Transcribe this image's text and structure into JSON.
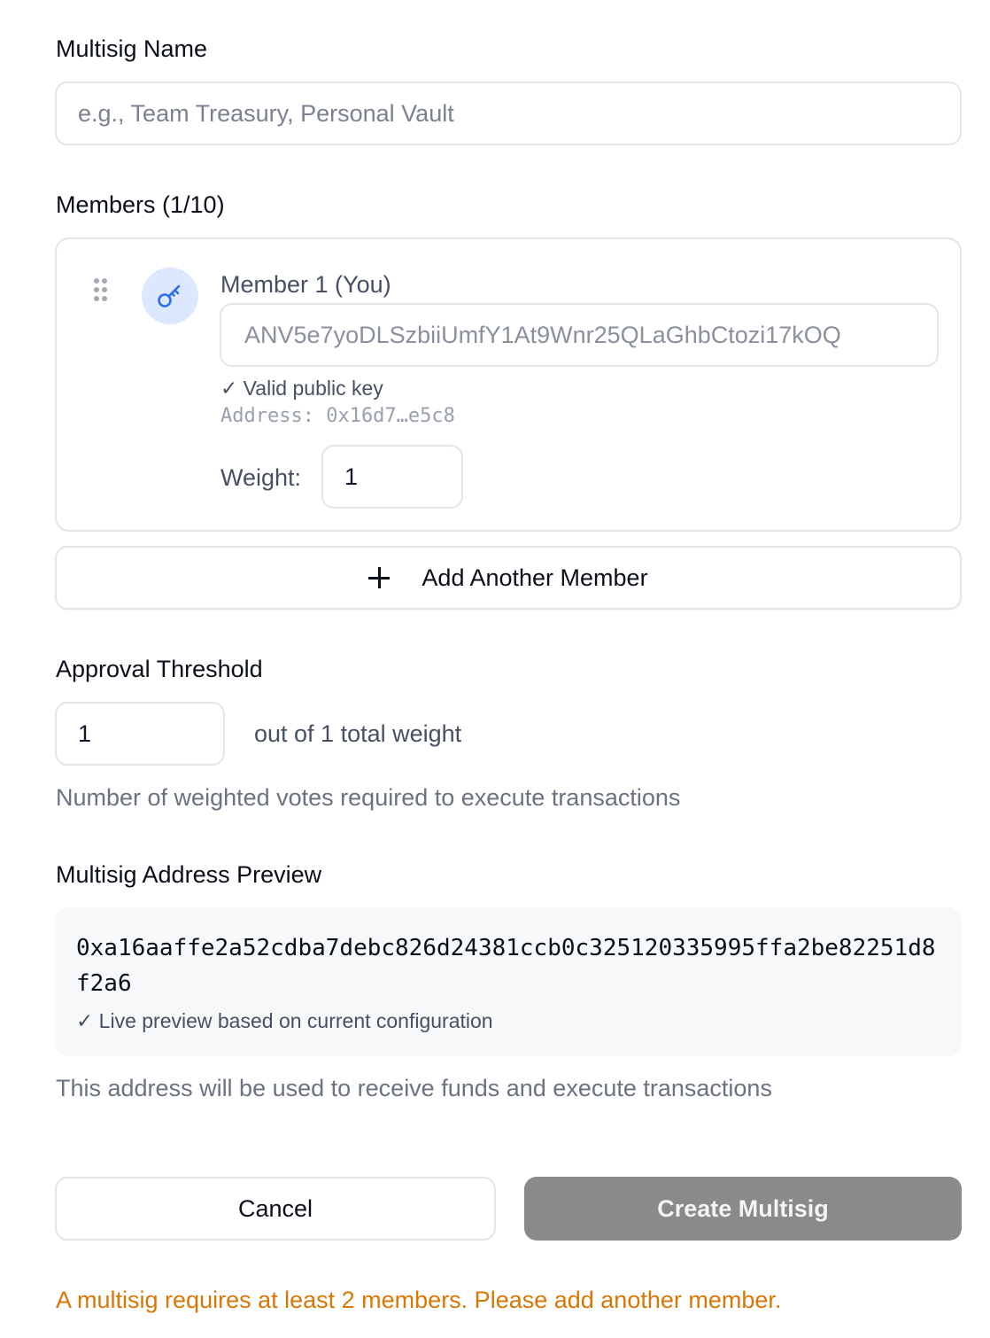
{
  "multisig_name": {
    "label": "Multisig Name",
    "placeholder": "e.g., Team Treasury, Personal Vault",
    "value": ""
  },
  "members": {
    "heading": "Members (1/10)",
    "items": [
      {
        "label": "Member 1 (You)",
        "public_key": "ANV5e7yoDLSzbiiUmfY1At9Wnr25QLaGhbCtozi17kOQ",
        "validation": "✓ Valid public key",
        "address": "Address: 0x16d7…e5c8",
        "weight_label": "Weight:",
        "weight": "1",
        "icon": "key-icon"
      }
    ],
    "add_button_label": "Add Another Member"
  },
  "threshold": {
    "label": "Approval Threshold",
    "value": "1",
    "out_of": "out of 1 total weight",
    "help": "Number of weighted votes required to execute transactions"
  },
  "preview": {
    "label": "Multisig Address Preview",
    "address": "0xa16aaffe2a52cdba7debc826d24381ccb0c325120335995ffa2be82251d8f2a6",
    "note": "✓ Live preview based on current configuration",
    "help": "This address will be used to receive funds and execute transactions"
  },
  "actions": {
    "cancel_label": "Cancel",
    "create_label": "Create Multisig"
  },
  "error_message": "A multisig requires at least 2 members. Please add another member.",
  "colors": {
    "accent": "#2f6ee8",
    "avatar_bg": "#dbe8fd",
    "disabled_button": "#8a8a8a",
    "error": "#d97706"
  }
}
